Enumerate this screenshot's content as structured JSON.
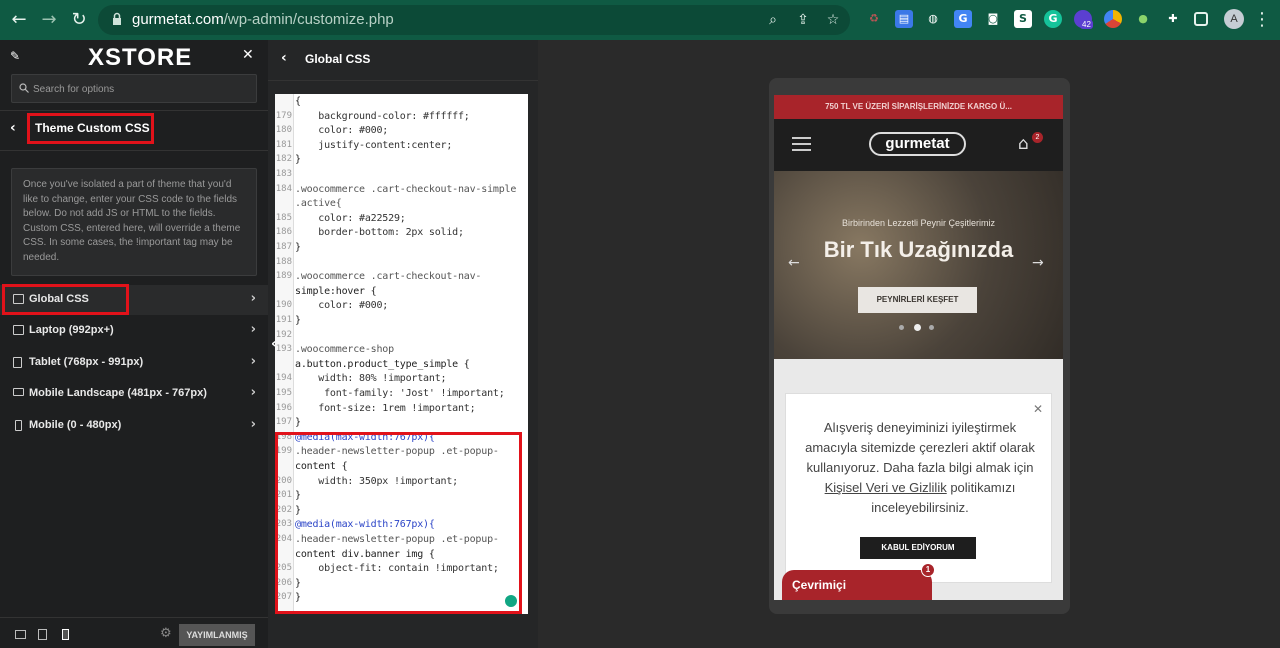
{
  "browser": {
    "url_host": "gurmetat.com",
    "url_path": "/wp-admin/customize.php",
    "profile_initial": "A",
    "extension_badge": "42",
    "colors": {
      "frame": "#0f5a43",
      "omnibox": "#0c4a37"
    }
  },
  "sidebar": {
    "logo": "XSTORE",
    "search_placeholder": "Search for options",
    "section_title": "Theme Custom CSS",
    "description": "Once you've isolated a part of theme that you'd like to change, enter your CSS code to the fields below. Do not add JS or HTML to the fields. Custom CSS, entered here, will override a theme CSS. In some cases, the !important tag may be needed.",
    "items": [
      {
        "label": "Global CSS"
      },
      {
        "label": "Laptop (992px+)"
      },
      {
        "label": "Tablet (768px - 991px)"
      },
      {
        "label": "Mobile Landscape (481px - 767px)"
      },
      {
        "label": "Mobile (0 - 480px)"
      }
    ],
    "publish_label": "YAYIMLANMIŞ"
  },
  "editor": {
    "title": "Global CSS",
    "lines": [
      {
        "n": "",
        "t": "{"
      },
      {
        "n": "179",
        "t": "    background-color: #ffffff;"
      },
      {
        "n": "180",
        "t": "    color: #000;"
      },
      {
        "n": "181",
        "t": "    justify-content:center;"
      },
      {
        "n": "182",
        "t": "}"
      },
      {
        "n": "183",
        "t": ""
      },
      {
        "n": "184",
        "t": ".woocommerce .cart-checkout-nav-simple"
      },
      {
        "n": "",
        "t": ".active{"
      },
      {
        "n": "185",
        "t": "    color: #a22529;"
      },
      {
        "n": "186",
        "t": "    border-bottom: 2px solid;"
      },
      {
        "n": "187",
        "t": "}"
      },
      {
        "n": "188",
        "t": ""
      },
      {
        "n": "189",
        "t": ".woocommerce .cart-checkout-nav-"
      },
      {
        "n": "",
        "t": "simple:hover {"
      },
      {
        "n": "190",
        "t": "    color: #000;"
      },
      {
        "n": "191",
        "t": "}"
      },
      {
        "n": "192",
        "t": ""
      },
      {
        "n": "193",
        "t": ".woocommerce-shop"
      },
      {
        "n": "",
        "t": "a.button.product_type_simple {"
      },
      {
        "n": "194",
        "t": "    width: 80% !important;"
      },
      {
        "n": "195",
        "t": "     font-family: 'Jost' !important;"
      },
      {
        "n": "196",
        "t": "    font-size: 1rem !important;"
      },
      {
        "n": "197",
        "t": "}"
      },
      {
        "n": "198",
        "t": "@media(max-width:767px){"
      },
      {
        "n": "199",
        "t": ".header-newsletter-popup .et-popup-"
      },
      {
        "n": "",
        "t": "content {"
      },
      {
        "n": "200",
        "t": "    width: 350px !important;"
      },
      {
        "n": "201",
        "t": "}"
      },
      {
        "n": "202",
        "t": "}"
      },
      {
        "n": "203",
        "t": "@media(max-width:767px){"
      },
      {
        "n": "204",
        "t": ".header-newsletter-popup .et-popup-"
      },
      {
        "n": "",
        "t": "content div.banner img {"
      },
      {
        "n": "205",
        "t": "    object-fit: contain !important;"
      },
      {
        "n": "206",
        "t": "}"
      },
      {
        "n": "207",
        "t": "}"
      }
    ]
  },
  "preview": {
    "promo": "750 TL VE ÜZERİ SİPARİŞLERİNİZDE KARGO Ü...",
    "brand": "gurmetat",
    "cart_count": "2",
    "hero_sub": "Birbirinden Lezzetli Peynir Çeşitlerimiz",
    "hero_title": "Bir Tık Uzağınızda",
    "hero_button": "PEYNİRLERİ KEŞFET",
    "cookie_text_1": "Alışveriş deneyiminizi iyileştirmek amacıyla sitemizde çerezleri aktif olarak kullanıyoruz. Daha fazla bilgi almak için ",
    "cookie_link": "Kişisel Veri ve Gizlilik",
    "cookie_text_2": " politikamızı inceleyebilirsiniz.",
    "cookie_button": "KABUL EDİYORUM",
    "chat_label": "Çevrimiçi",
    "chat_badge": "1",
    "colors": {
      "accent": "#a8242a"
    }
  }
}
